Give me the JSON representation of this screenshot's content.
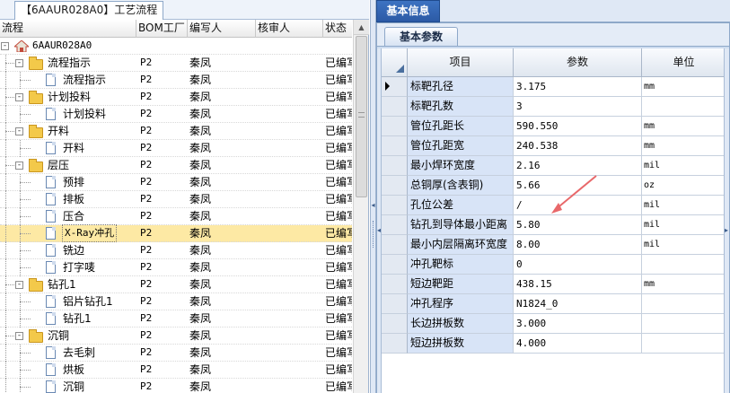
{
  "left": {
    "tab_label": "【6AAUR028A0】工艺流程",
    "columns": [
      "流程",
      "BOM工厂",
      "编写人",
      "核审人",
      "状态"
    ],
    "rows": [
      {
        "name": "6AAUR028A0",
        "kind": "root",
        "level": 0,
        "toggle": "-",
        "bom": "",
        "writer": "",
        "reviewer": "",
        "status": ""
      },
      {
        "name": "流程指示",
        "kind": "folder",
        "level": 1,
        "toggle": "-",
        "bom": "P2",
        "writer": "秦凤",
        "reviewer": "",
        "status": "已编写"
      },
      {
        "name": "流程指示",
        "kind": "doc",
        "level": 2,
        "toggle": "",
        "bom": "P2",
        "writer": "秦凤",
        "reviewer": "",
        "status": "已编写"
      },
      {
        "name": "计划投料",
        "kind": "folder",
        "level": 1,
        "toggle": "-",
        "bom": "P2",
        "writer": "秦凤",
        "reviewer": "",
        "status": "已编写"
      },
      {
        "name": "计划投料",
        "kind": "doc",
        "level": 2,
        "toggle": "",
        "bom": "P2",
        "writer": "秦凤",
        "reviewer": "",
        "status": "已编写"
      },
      {
        "name": "开料",
        "kind": "folder",
        "level": 1,
        "toggle": "-",
        "bom": "P2",
        "writer": "秦凤",
        "reviewer": "",
        "status": "已编写"
      },
      {
        "name": "开料",
        "kind": "doc",
        "level": 2,
        "toggle": "",
        "bom": "P2",
        "writer": "秦凤",
        "reviewer": "",
        "status": "已编写"
      },
      {
        "name": "层压",
        "kind": "folder",
        "level": 1,
        "toggle": "-",
        "bom": "P2",
        "writer": "秦凤",
        "reviewer": "",
        "status": "已编写"
      },
      {
        "name": "预排",
        "kind": "doc",
        "level": 2,
        "toggle": "",
        "bom": "P2",
        "writer": "秦凤",
        "reviewer": "",
        "status": "已编写"
      },
      {
        "name": "排板",
        "kind": "doc",
        "level": 2,
        "toggle": "",
        "bom": "P2",
        "writer": "秦凤",
        "reviewer": "",
        "status": "已编写"
      },
      {
        "name": "压合",
        "kind": "doc",
        "level": 2,
        "toggle": "",
        "bom": "P2",
        "writer": "秦凤",
        "reviewer": "",
        "status": "已编写"
      },
      {
        "name": "X-Ray冲孔",
        "kind": "doc",
        "level": 2,
        "toggle": "",
        "bom": "P2",
        "writer": "秦凤",
        "reviewer": "",
        "status": "已编写",
        "selected": true
      },
      {
        "name": "铣边",
        "kind": "doc",
        "level": 2,
        "toggle": "",
        "bom": "P2",
        "writer": "秦凤",
        "reviewer": "",
        "status": "已编写"
      },
      {
        "name": "打字唛",
        "kind": "doc",
        "level": 2,
        "toggle": "",
        "bom": "P2",
        "writer": "秦凤",
        "reviewer": "",
        "status": "已编写"
      },
      {
        "name": "钻孔1",
        "kind": "folder",
        "level": 1,
        "toggle": "-",
        "bom": "P2",
        "writer": "秦凤",
        "reviewer": "",
        "status": "已编写"
      },
      {
        "name": "铝片钻孔1",
        "kind": "doc",
        "level": 2,
        "toggle": "",
        "bom": "P2",
        "writer": "秦凤",
        "reviewer": "",
        "status": "已编写"
      },
      {
        "name": "钻孔1",
        "kind": "doc",
        "level": 2,
        "toggle": "",
        "bom": "P2",
        "writer": "秦凤",
        "reviewer": "",
        "status": "已编写"
      },
      {
        "name": "沉铜",
        "kind": "folder",
        "level": 1,
        "toggle": "-",
        "bom": "P2",
        "writer": "秦凤",
        "reviewer": "",
        "status": "已编写"
      },
      {
        "name": "去毛刺",
        "kind": "doc",
        "level": 2,
        "toggle": "",
        "bom": "P2",
        "writer": "秦凤",
        "reviewer": "",
        "status": "已编写"
      },
      {
        "name": "烘板",
        "kind": "doc",
        "level": 2,
        "toggle": "",
        "bom": "P2",
        "writer": "秦凤",
        "reviewer": "",
        "status": "已编写"
      },
      {
        "name": "沉铜",
        "kind": "doc",
        "level": 2,
        "toggle": "",
        "bom": "P2",
        "writer": "秦凤",
        "reviewer": "",
        "status": "已编写"
      }
    ]
  },
  "right": {
    "tab_label": "基本信息",
    "subtab_label": "基本参数",
    "columns": [
      "项目",
      "参数",
      "单位"
    ],
    "rows": [
      {
        "item": "标靶孔径",
        "value": "3.175",
        "unit": "mm",
        "current": true
      },
      {
        "item": "标靶孔数",
        "value": "3",
        "unit": ""
      },
      {
        "item": "管位孔距长",
        "value": "590.550",
        "unit": "mm"
      },
      {
        "item": "管位孔距宽",
        "value": "240.538",
        "unit": "mm"
      },
      {
        "item": "最小焊环宽度",
        "value": "2.16",
        "unit": "mil"
      },
      {
        "item": "总铜厚(含表铜)",
        "value": "5.66",
        "unit": "oz"
      },
      {
        "item": "孔位公差",
        "value": "/",
        "unit": "mil"
      },
      {
        "item": "钻孔到导体最小距离",
        "value": "5.80",
        "unit": "mil"
      },
      {
        "item": "最小内层隔离环宽度",
        "value": "8.00",
        "unit": "mil"
      },
      {
        "item": "冲孔靶标",
        "value": "0",
        "unit": ""
      },
      {
        "item": "短边靶距",
        "value": "438.15",
        "unit": "mm"
      },
      {
        "item": "冲孔程序",
        "value": "N1824_0",
        "unit": ""
      },
      {
        "item": "长边拼板数",
        "value": "3.000",
        "unit": ""
      },
      {
        "item": "短边拼板数",
        "value": "4.000",
        "unit": ""
      }
    ]
  },
  "colors": {
    "selected_row": "#fde9a4",
    "key_cell": "#d8e4f7",
    "tab_blue": "#2c5aa5",
    "annotation_arrow": "#e8686a"
  }
}
